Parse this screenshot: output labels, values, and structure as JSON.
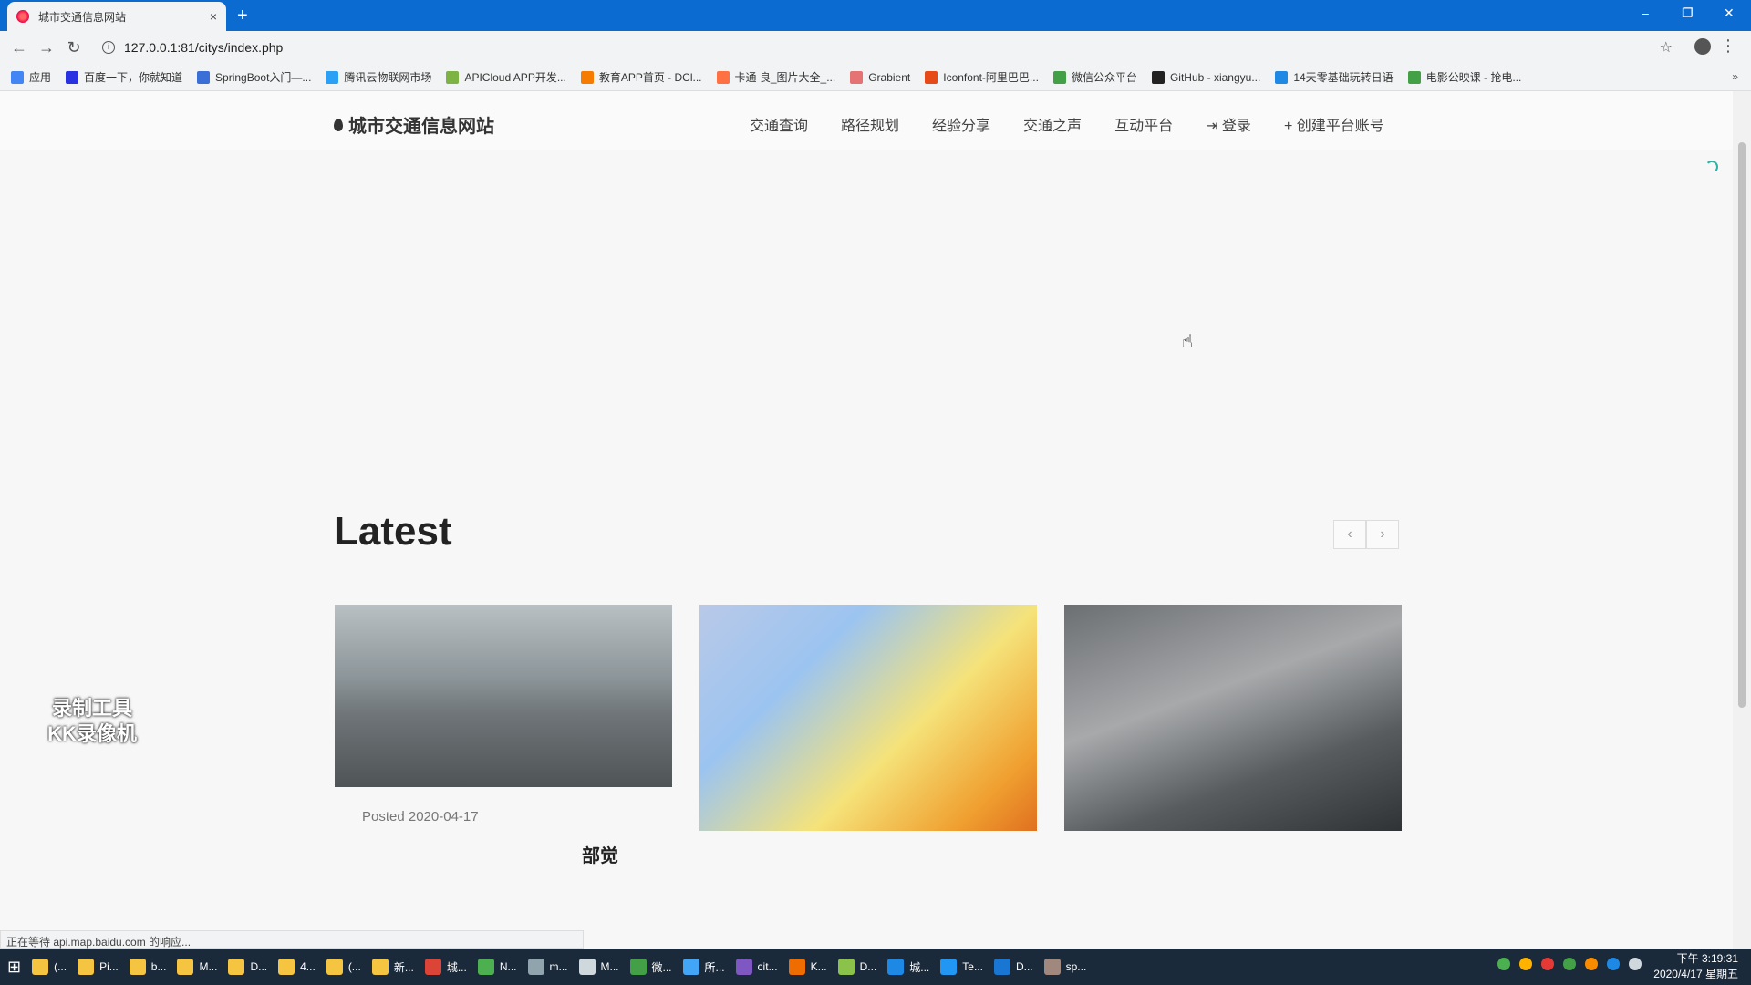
{
  "browser": {
    "tab_title": "城市交通信息网站",
    "tab_close": "×",
    "new_tab": "+",
    "url": "127.0.0.1:81/citys/index.php",
    "status": "正在等待 api.map.baidu.com 的响应...",
    "window_controls": [
      "–",
      "❐",
      "✕"
    ],
    "bookmarks_more": "»",
    "bookmarks": [
      {
        "label": "应用",
        "color": "#4285f4"
      },
      {
        "label": "百度一下，你就知道",
        "color": "#2932e1"
      },
      {
        "label": "SpringBoot入门—...",
        "color": "#3b6fd8"
      },
      {
        "label": "腾讯云物联网市场",
        "color": "#2aa1f5"
      },
      {
        "label": "APICloud APP开发...",
        "color": "#7cb342"
      },
      {
        "label": "教育APP首页 - DCl...",
        "color": "#f57c00"
      },
      {
        "label": "卡通 良_图片大全_...",
        "color": "#ff7043"
      },
      {
        "label": "Grabient",
        "color": "#e57373"
      },
      {
        "label": "Iconfont-阿里巴巴...",
        "color": "#e64a19"
      },
      {
        "label": "微信公众平台",
        "color": "#43a047"
      },
      {
        "label": "GitHub - xiangyu...",
        "color": "#222222"
      },
      {
        "label": "14天零基础玩转日语",
        "color": "#1e88e5"
      },
      {
        "label": "电影公映课 - 抢电...",
        "color": "#43a047"
      }
    ]
  },
  "site": {
    "logo": "城市交通信息网站",
    "nav": [
      "交通查询",
      "路径规划",
      "经验分享",
      "交通之声",
      "互动平台",
      "⇥ 登录",
      "+ 创建平台账号"
    ]
  },
  "latest": {
    "title": "Latest",
    "prev": "‹",
    "next": "›",
    "posted": "Posted 2020-04-17",
    "partial_text": "部觉"
  },
  "watermark": [
    "录制工具",
    "KK录像机"
  ],
  "taskbar": {
    "items": [
      {
        "label": "(...",
        "color": "#f5c542"
      },
      {
        "label": "Pi...",
        "color": "#f5c542"
      },
      {
        "label": "b...",
        "color": "#f5c542"
      },
      {
        "label": "M...",
        "color": "#f5c542"
      },
      {
        "label": "D...",
        "color": "#f5c542"
      },
      {
        "label": "4...",
        "color": "#f5c542"
      },
      {
        "label": "(...",
        "color": "#f5c542"
      },
      {
        "label": "新...",
        "color": "#f5c542"
      },
      {
        "label": "城...",
        "color": "#db4437"
      },
      {
        "label": "N...",
        "color": "#4caf50"
      },
      {
        "label": "m...",
        "color": "#90a4ae"
      },
      {
        "label": "M...",
        "color": "#cfd8dc"
      },
      {
        "label": "微...",
        "color": "#43a047"
      },
      {
        "label": "所...",
        "color": "#42a5f5"
      },
      {
        "label": "cit...",
        "color": "#7e57c2"
      },
      {
        "label": "K...",
        "color": "#ef6c00"
      },
      {
        "label": "D...",
        "color": "#8bc34a"
      },
      {
        "label": "城...",
        "color": "#1e88e5"
      },
      {
        "label": "Te...",
        "color": "#2196f3"
      },
      {
        "label": "D...",
        "color": "#1976d2"
      },
      {
        "label": "sp...",
        "color": "#a1887f"
      }
    ],
    "time": "下午 3:19:31",
    "date": "2020/4/17 星期五"
  }
}
